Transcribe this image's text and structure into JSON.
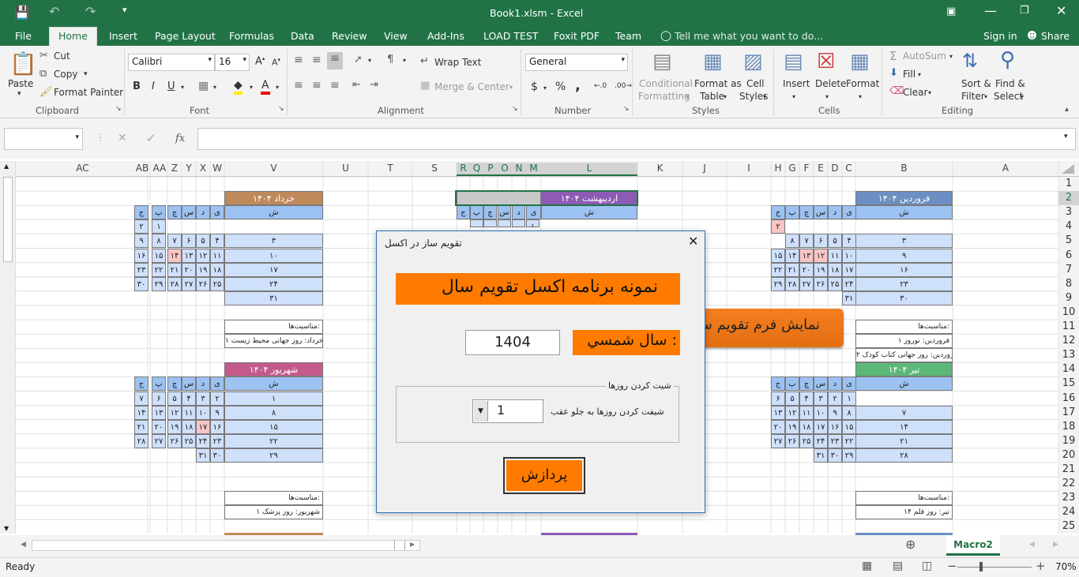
{
  "app": {
    "title": "Book1.xlsm - Excel"
  },
  "tabs": {
    "file": "File",
    "home": "Home",
    "insert": "Insert",
    "page_layout": "Page Layout",
    "formulas": "Formulas",
    "data": "Data",
    "review": "Review",
    "view": "View",
    "addins": "Add-Ins",
    "load_test": "LOAD TEST",
    "foxit": "Foxit PDF",
    "team": "Team",
    "tell_me": "Tell me what you want to do...",
    "sign_in": "Sign in",
    "share": "Share"
  },
  "ribbon": {
    "paste": "Paste",
    "cut": "Cut",
    "copy": "Copy",
    "format_painter": "Format Painter",
    "clipboard": "Clipboard",
    "font_name": "Calibri",
    "font_size": "16",
    "font": "Font",
    "bold": "B",
    "italic": "I",
    "underline": "U",
    "wrap_text": "Wrap Text",
    "merge_center": "Merge & Center",
    "alignment": "Alignment",
    "number_format": "General",
    "number": "Number",
    "currency": "$",
    "percent": "%",
    "comma": ",",
    "conditional": "Conditional",
    "formatting": "Formatting",
    "format_as": "Format as",
    "table": "Table",
    "cell": "Cell",
    "styles_lbl": "Styles",
    "styles": "Styles",
    "insert": "Insert",
    "delete": "Delete",
    "format": "Format",
    "cells": "Cells",
    "autosum": "AutoSum",
    "fill": "Fill",
    "clear": "Clear",
    "sort": "Sort &",
    "filter": "Filter",
    "find": "Find &",
    "select": "Select",
    "editing": "Editing"
  },
  "formula_bar": {
    "fx": "fx",
    "content": ""
  },
  "columns": [
    {
      "label": "AC"
    },
    {
      "label": "AB"
    },
    {
      "label": "AA"
    },
    {
      "label": "Z"
    },
    {
      "label": "Y"
    },
    {
      "label": "X"
    },
    {
      "label": "W"
    },
    {
      "label": "V"
    },
    {
      "label": "U"
    },
    {
      "label": "T"
    },
    {
      "label": "S"
    },
    {
      "label": "R"
    },
    {
      "label": "Q"
    },
    {
      "label": "P"
    },
    {
      "label": "O"
    },
    {
      "label": "N"
    },
    {
      "label": "M"
    },
    {
      "label": "L"
    },
    {
      "label": "K"
    },
    {
      "label": "J"
    },
    {
      "label": "I"
    },
    {
      "label": "H"
    },
    {
      "label": "G"
    },
    {
      "label": "F"
    },
    {
      "label": "E"
    },
    {
      "label": "D"
    },
    {
      "label": "C"
    },
    {
      "label": "B"
    },
    {
      "label": "A"
    }
  ],
  "rows": [
    "1",
    "2",
    "3",
    "4",
    "5",
    "6",
    "7",
    "8",
    "9",
    "10",
    "11",
    "12",
    "13",
    "14",
    "15",
    "16",
    "17",
    "18",
    "19",
    "20",
    "21",
    "22",
    "23",
    "24",
    "25"
  ],
  "calendar": {
    "khordad": "خرداد ۱۴۰۴",
    "ordibehesht": "اردیبهشت ۱۴۰۴",
    "farvardin": "فروردین ۱۴۰۴",
    "shahrivar": "شهریور ۱۴۰۴",
    "tir": "تیر ۱۴۰۴",
    "weekdays": [
      "ش",
      "ی",
      "د",
      "س",
      "چ",
      "پ",
      "ج"
    ],
    "occasions": "مناسبت‌ها:",
    "khordad_note": "خرداد: روز جهانی محیط زیست ۱",
    "farvardin_note1": "فروردین: نوروز ۱",
    "farvardin_note2": "فروردین: روز جهانی کتاب کودک ۲",
    "shahrivar_note": "شهریور: روز پزشک ۱",
    "tir_note": "تیر: روز قلم ۱۴",
    "khordad_rows": [
      [
        "",
        "",
        "",
        "",
        "",
        "۱",
        "۲"
      ],
      [
        "۳",
        "۴",
        "۵",
        "۶",
        "۷",
        "۸",
        "۹"
      ],
      [
        "۱۰",
        "۱۱",
        "۱۲",
        "۱۳",
        "۱۴",
        "۱۵",
        "۱۶"
      ],
      [
        "۱۷",
        "۱۸",
        "۱۹",
        "۲۰",
        "۲۱",
        "۲۲",
        "۲۳"
      ],
      [
        "۲۴",
        "۲۵",
        "۲۶",
        "۲۷",
        "۲۸",
        "۲۹",
        "۳۰"
      ],
      [
        "۳۱",
        "",
        "",
        "",
        "",
        "",
        ""
      ]
    ],
    "farvardin_rows": [
      [
        "",
        "",
        "",
        "",
        "",
        "",
        "۲"
      ],
      [
        "۳",
        "۴",
        "۵",
        "۶",
        "۷",
        "۸",
        ""
      ],
      [
        "۹",
        "۱۰",
        "۱۱",
        "۱۲",
        "۱۳",
        "۱۴",
        "۱۵"
      ],
      [
        "۱۶",
        "۱۷",
        "۱۸",
        "۱۹",
        "۲۰",
        "۲۱",
        "۲۲"
      ],
      [
        "۲۳",
        "۲۴",
        "۲۵",
        "۲۶",
        "۲۷",
        "۲۸",
        "۲۹"
      ],
      [
        "۳۰",
        "۳۱",
        "",
        "",
        "",
        "",
        ""
      ]
    ],
    "shahrivar_rows": [
      [
        "۱",
        "۲",
        "۳",
        "۴",
        "۵",
        "۶",
        "۷"
      ],
      [
        "۸",
        "۹",
        "۱۰",
        "۱۱",
        "۱۲",
        "۱۳",
        "۱۴"
      ],
      [
        "۱۵",
        "۱۶",
        "۱۷",
        "۱۸",
        "۱۹",
        "۲۰",
        "۲۱"
      ],
      [
        "۲۲",
        "۲۳",
        "۲۴",
        "۲۵",
        "۲۶",
        "۲۷",
        "۲۸"
      ],
      [
        "۲۹",
        "۳۰",
        "۳۱",
        "",
        "",
        "",
        ""
      ]
    ],
    "tir_rows": [
      [
        "",
        "۱",
        "۲",
        "۳",
        "۴",
        "۵",
        "۶"
      ],
      [
        "۷",
        "۸",
        "۹",
        "۱۰",
        "۱۱",
        "۱۲",
        "۱۳"
      ],
      [
        "۱۴",
        "۱۵",
        "۱۶",
        "۱۷",
        "۱۸",
        "۱۹",
        "۲۰"
      ],
      [
        "۲۱",
        "۲۲",
        "۲۳",
        "۲۴",
        "۲۵",
        "۲۶",
        "۲۷"
      ],
      [
        "۲۸",
        "۲۹",
        "۳۰",
        "۳۱",
        "",
        "",
        ""
      ]
    ],
    "ord_row4": [
      "۱",
      "",
      "",
      "",
      ""
    ]
  },
  "shape_button": "نمایش فرم تقویم ساز",
  "dialog": {
    "title": "تقویم ساز در اکسل",
    "banner": "نمونه برنامه اکسل تقویم سال",
    "year_label": "سال شمسي :",
    "year_value": "1404",
    "group_title": "شیت کردن روزها",
    "shift_label": "شیفت کردن روزها به جلو عقب",
    "shift_value": "1",
    "process": "پردازش"
  },
  "sheet_tab": "Macro2",
  "status": {
    "ready": "Ready",
    "zoom": "70%"
  }
}
